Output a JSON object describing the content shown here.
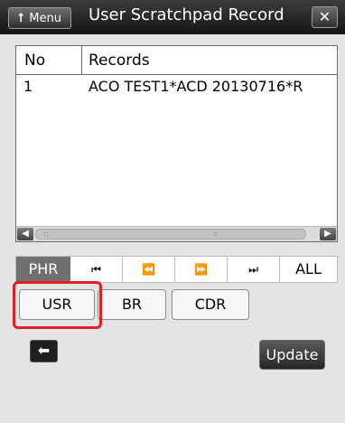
{
  "header": {
    "menu_arrow": "⭡",
    "menu_label": "Menu",
    "title": "User Scratchpad Record",
    "close_label": "✕"
  },
  "records": {
    "columns": {
      "no": "No",
      "records": "Records"
    },
    "rows": [
      {
        "no": "1",
        "record": "ACO TEST1*ACD 20130716*R"
      }
    ]
  },
  "scrollbar": {
    "left_arrow": "◀",
    "right_arrow": "▶",
    "grip": "::"
  },
  "nav": {
    "phr": "PHR",
    "first": "⏮",
    "prev": "⏪",
    "next": "⏩",
    "last": "⏭",
    "all": "ALL"
  },
  "record_types": {
    "usr": "USR",
    "br": "BR",
    "cdr": "CDR"
  },
  "actions": {
    "back": "⬅",
    "update": "Update"
  },
  "colors": {
    "highlight": "#e02020",
    "title_bar": "#151515"
  }
}
